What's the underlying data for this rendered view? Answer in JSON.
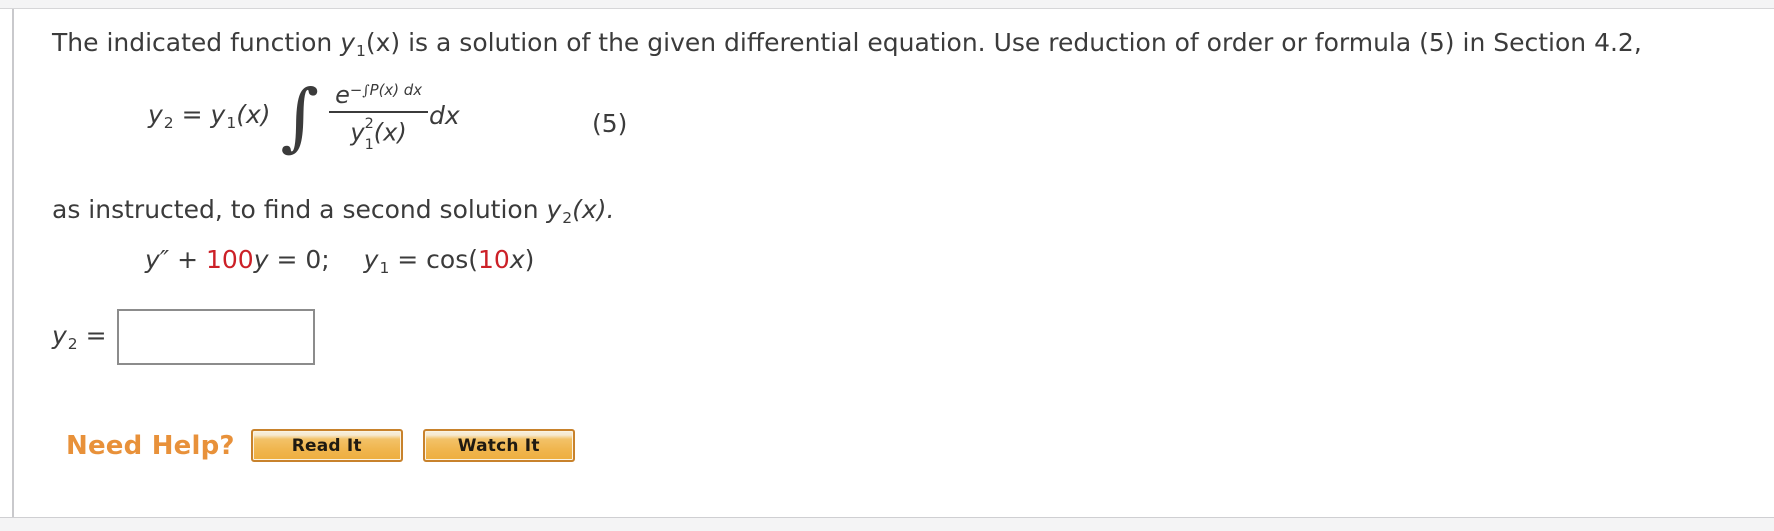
{
  "problem": {
    "prompt_parts": {
      "p1": "The indicated function ",
      "y1_var": "y",
      "y1_sub": "1",
      "p2": "(x) is a solution of the given differential equation. Use reduction of order or formula (5) in Section 4.2,"
    },
    "formula": {
      "lhs_var": "y",
      "lhs_sub": "2",
      "equals": " = ",
      "factor_var": "y",
      "factor_sub": "1",
      "factor_arg": "(x)",
      "integral_sign": "∫",
      "numerator_base": "e",
      "numerator_exponent_minus": "−",
      "numerator_exponent_integral": "∫",
      "numerator_exponent_rest": "P(x) dx",
      "denominator_var": "y",
      "denominator_sup": "2",
      "denominator_sub": "1",
      "denominator_arg": "(x)",
      "tail_dx": "dx",
      "equation_number": "(5)"
    },
    "instructed_parts": {
      "p1": "as instructed, to find a second solution ",
      "y2_var": "y",
      "y2_sub": "2",
      "p2": "(x)."
    },
    "equation": {
      "lhs_y": "y",
      "primes": "″",
      "plus": " + ",
      "coefficient": "100",
      "y_term": "y",
      "equals_zero": " = 0;",
      "y1_var": "y",
      "y1_sub": "1",
      "y1_equals": " = cos(",
      "inner_coefficient": "10",
      "inner_var": "x",
      "close_paren": ")"
    },
    "answer": {
      "label_var": "y",
      "label_sub": "2",
      "label_equals": " =",
      "input_value": "",
      "input_placeholder": ""
    },
    "help": {
      "label": "Need Help?",
      "buttons": [
        {
          "label": "Read It"
        },
        {
          "label": "Watch It"
        }
      ]
    },
    "colors": {
      "red_accent": "#cc2027",
      "help_orange": "#e8913a",
      "button_border": "#c8822c",
      "text": "#3b3b3b"
    }
  }
}
